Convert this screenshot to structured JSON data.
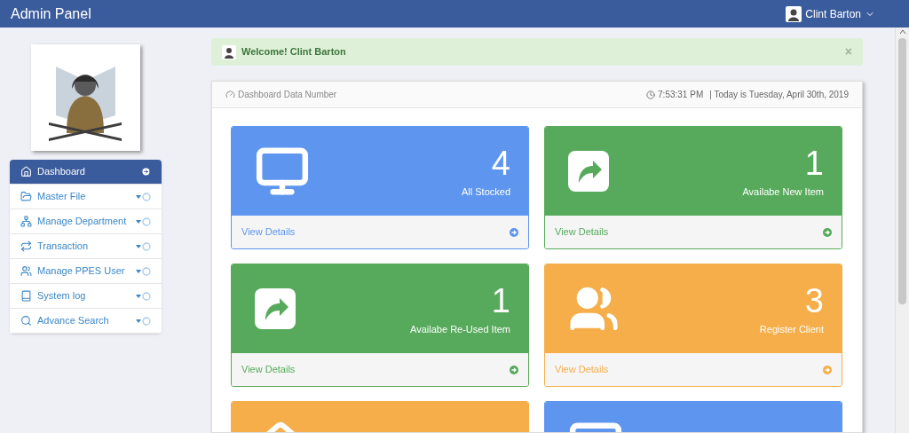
{
  "header": {
    "title": "Admin Panel",
    "user": "Clint Barton"
  },
  "sidebar": {
    "items": [
      {
        "label": "Dashboard",
        "selected": true
      },
      {
        "label": "Master File",
        "selected": false
      },
      {
        "label": "Manage Department",
        "selected": false
      },
      {
        "label": "Transaction",
        "selected": false
      },
      {
        "label": "Manage PPES User",
        "selected": false
      },
      {
        "label": "System log",
        "selected": false
      },
      {
        "label": "Advance Search",
        "selected": false
      }
    ]
  },
  "alert": {
    "message": "Welcome! Clint Barton",
    "close": "×"
  },
  "panel": {
    "title": "Dashboard Data Number",
    "time": "7:53:31 PM",
    "date": "| Today is Tuesday, April 30th, 2019"
  },
  "cards": [
    {
      "kind": "monitor",
      "color": "#5e95ee",
      "value": "4",
      "label": "All Stocked",
      "link": "View Details"
    },
    {
      "kind": "share",
      "color": "#57aa5b",
      "value": "1",
      "label": "Availabe New Item",
      "link": "View Details"
    },
    {
      "kind": "share",
      "color": "#57aa5b",
      "value": "1",
      "label": "Availabe Re-Used Item",
      "link": "View Details"
    },
    {
      "kind": "users",
      "color": "#f5ae4a",
      "value": "3",
      "label": "Register Client",
      "link": "View Details"
    },
    {
      "kind": "home",
      "color": "#f5ae4a"
    },
    {
      "kind": "monitor",
      "color": "#5e95ee"
    }
  ]
}
